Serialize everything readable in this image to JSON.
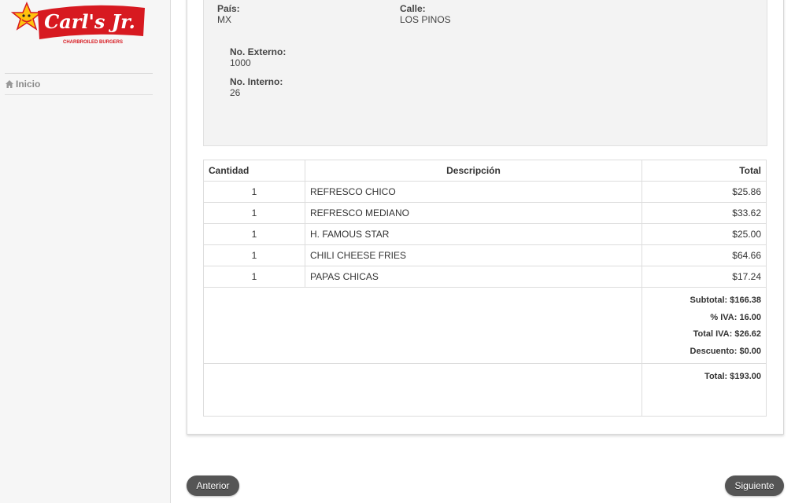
{
  "sidebar": {
    "logo_text": "Carl's Jr.",
    "logo_tagline": "CHARBROILED BURGERS",
    "nav_items": [
      {
        "label": "Inicio",
        "icon": "home-icon"
      }
    ]
  },
  "address": {
    "pais_label": "País:",
    "pais_value": "MX",
    "calle_label": "Calle:",
    "calle_value": "LOS PINOS",
    "no_externo_label": "No. Externo:",
    "no_externo_value": "1000",
    "no_interno_label": "No. Interno:",
    "no_interno_value": "26"
  },
  "table": {
    "headers": {
      "qty": "Cantidad",
      "desc": "Descripción",
      "total": "Total"
    },
    "rows": [
      {
        "qty": "1",
        "desc": "REFRESCO CHICO",
        "total": "$25.86"
      },
      {
        "qty": "1",
        "desc": "REFRESCO MEDIANO",
        "total": "$33.62"
      },
      {
        "qty": "1",
        "desc": "H. FAMOUS STAR",
        "total": "$25.00"
      },
      {
        "qty": "1",
        "desc": "CHILI CHEESE FRIES",
        "total": "$64.66"
      },
      {
        "qty": "1",
        "desc": "PAPAS CHICAS",
        "total": "$17.24"
      }
    ],
    "summary": {
      "subtotal": "Subtotal: $166.38",
      "iva_pct": "% IVA: 16.00",
      "total_iva": "Total IVA: $26.62",
      "descuento": "Descuento: $0.00",
      "total": "Total: $193.00"
    }
  },
  "buttons": {
    "prev_label": "Anterior",
    "next_label": "Siguiente"
  },
  "colors": {
    "brand_red": "#d71920",
    "brand_yellow": "#ffc20e",
    "button_bg": "#555555"
  }
}
